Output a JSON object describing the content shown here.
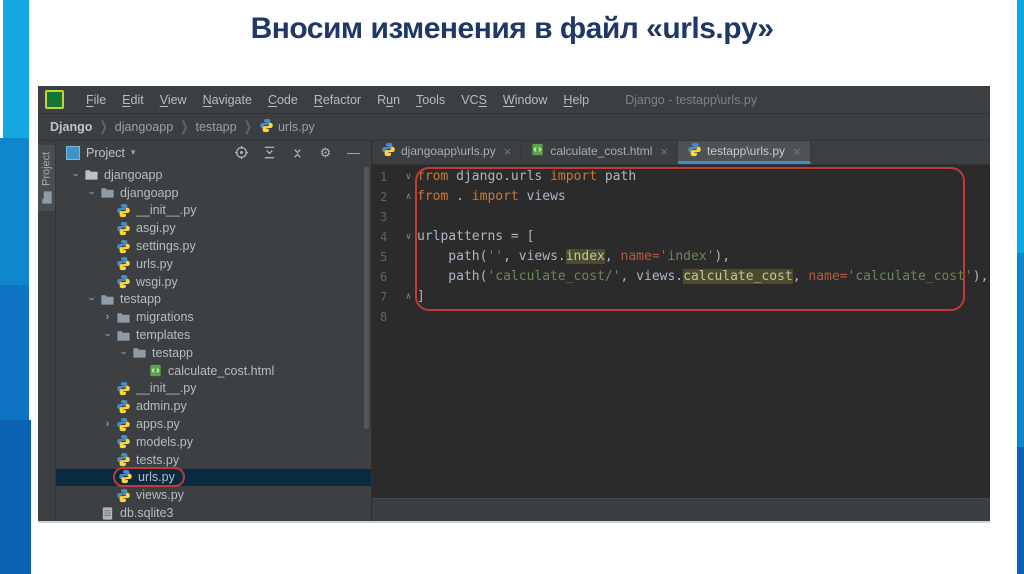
{
  "slide": {
    "title": "Вносим изменения в файл «urls.py»"
  },
  "window": {
    "title": "Django - testapp\\urls.py"
  },
  "colors": {
    "title_color": "#1F3866",
    "window_bg": "#3C3F41",
    "editor_bg": "#2B2B2B",
    "accent_blue": "#4A88C7",
    "annotation_red": "#C03A36",
    "selection_bg": "#0B2A40",
    "keyword": "#CC7832",
    "string": "#6A8759",
    "param": "#B35B3E",
    "highlight_bg": "#4E4B2B"
  },
  "menu": {
    "items": [
      {
        "label": "File",
        "u": 0
      },
      {
        "label": "Edit",
        "u": 0
      },
      {
        "label": "View",
        "u": 0
      },
      {
        "label": "Navigate",
        "u": 0
      },
      {
        "label": "Code",
        "u": 0
      },
      {
        "label": "Refactor",
        "u": 0
      },
      {
        "label": "Run",
        "u": 1
      },
      {
        "label": "Tools",
        "u": 0
      },
      {
        "label": "VCS",
        "u": 2
      },
      {
        "label": "Window",
        "u": 0
      },
      {
        "label": "Help",
        "u": 0
      }
    ]
  },
  "breadcrumb": {
    "items": [
      {
        "label": "Django",
        "bold": true
      },
      {
        "label": "djangoapp"
      },
      {
        "label": "testapp"
      },
      {
        "label": "urls.py",
        "icon": "python-icon"
      }
    ]
  },
  "tool_button": {
    "label": "Project",
    "icon": "folder-icon"
  },
  "project_panel": {
    "header_label": "Project",
    "caret": "▾",
    "icons": [
      "locate-icon",
      "expand-all-icon",
      "collapse-all-icon",
      "gear-icon",
      "minimize-icon"
    ]
  },
  "tree": {
    "items": [
      {
        "label": "djangoapp",
        "icon": "folder-root-icon",
        "level": 0,
        "chevron": "open"
      },
      {
        "label": "djangoapp",
        "icon": "folder-icon",
        "level": 1,
        "chevron": "open"
      },
      {
        "label": "__init__.py",
        "icon": "python-icon",
        "level": 2
      },
      {
        "label": "asgi.py",
        "icon": "python-icon",
        "level": 2
      },
      {
        "label": "settings.py",
        "icon": "python-icon",
        "level": 2
      },
      {
        "label": "urls.py",
        "icon": "python-icon",
        "level": 2
      },
      {
        "label": "wsgi.py",
        "icon": "python-icon",
        "level": 2
      },
      {
        "label": "testapp",
        "icon": "folder-icon",
        "level": 1,
        "chevron": "open"
      },
      {
        "label": "migrations",
        "icon": "folder-icon",
        "level": 2,
        "chevron": "closed"
      },
      {
        "label": "templates",
        "icon": "folder-icon",
        "level": 2,
        "chevron": "open"
      },
      {
        "label": "testapp",
        "icon": "folder-icon",
        "level": 3,
        "chevron": "open"
      },
      {
        "label": "calculate_cost.html",
        "icon": "html-icon",
        "level": 4
      },
      {
        "label": "__init__.py",
        "icon": "python-icon",
        "level": 2
      },
      {
        "label": "admin.py",
        "icon": "python-icon",
        "level": 2
      },
      {
        "label": "apps.py",
        "icon": "python-icon",
        "level": 2,
        "chevron": "closed"
      },
      {
        "label": "models.py",
        "icon": "python-icon",
        "level": 2
      },
      {
        "label": "tests.py",
        "icon": "python-icon",
        "level": 2
      },
      {
        "label": "urls.py",
        "icon": "python-icon",
        "level": 2,
        "selected": true,
        "annotated": true
      },
      {
        "label": "views.py",
        "icon": "python-icon",
        "level": 2
      },
      {
        "label": "db.sqlite3",
        "icon": "database-icon",
        "level": 1
      }
    ]
  },
  "tabs": {
    "close_glyph": "×",
    "items": [
      {
        "label": "djangoapp\\urls.py",
        "icon": "python-icon",
        "active": false
      },
      {
        "label": "calculate_cost.html",
        "icon": "html-icon",
        "active": false
      },
      {
        "label": "testapp\\urls.py",
        "icon": "python-icon",
        "active": true
      }
    ]
  },
  "editor": {
    "lines": [
      {
        "n": "1",
        "fold": "v",
        "tokens": [
          [
            "kw",
            "from"
          ],
          [
            "d",
            " django.urls "
          ],
          [
            "kw",
            "import"
          ],
          [
            "d",
            " path"
          ]
        ]
      },
      {
        "n": "2",
        "fold": "^",
        "tokens": [
          [
            "kw",
            "from"
          ],
          [
            "d",
            " . "
          ],
          [
            "kw",
            "import"
          ],
          [
            "d",
            " views"
          ]
        ]
      },
      {
        "n": "3",
        "fold": "",
        "tokens": []
      },
      {
        "n": "4",
        "fold": "v",
        "tokens": [
          [
            "d",
            "urlpatterns = ["
          ]
        ]
      },
      {
        "n": "5",
        "fold": "",
        "tokens": [
          [
            "d",
            "    path("
          ],
          [
            "s",
            "''"
          ],
          [
            "d",
            ", views."
          ],
          [
            "hl",
            "index"
          ],
          [
            "d",
            ", "
          ],
          [
            "p",
            "name="
          ],
          [
            "s",
            "'index'"
          ],
          [
            "d",
            "),"
          ]
        ]
      },
      {
        "n": "6",
        "fold": "",
        "tokens": [
          [
            "d",
            "    path("
          ],
          [
            "s",
            "'calculate_cost/'"
          ],
          [
            "d",
            ", views."
          ],
          [
            "hl",
            "calculate_cost"
          ],
          [
            "d",
            ", "
          ],
          [
            "p",
            "name="
          ],
          [
            "s",
            "'calculate_cost'"
          ],
          [
            "d",
            "),"
          ]
        ]
      },
      {
        "n": "7",
        "fold": "^",
        "tokens": [
          [
            "d",
            "]"
          ]
        ]
      },
      {
        "n": "8",
        "fold": "",
        "tokens": []
      }
    ]
  }
}
